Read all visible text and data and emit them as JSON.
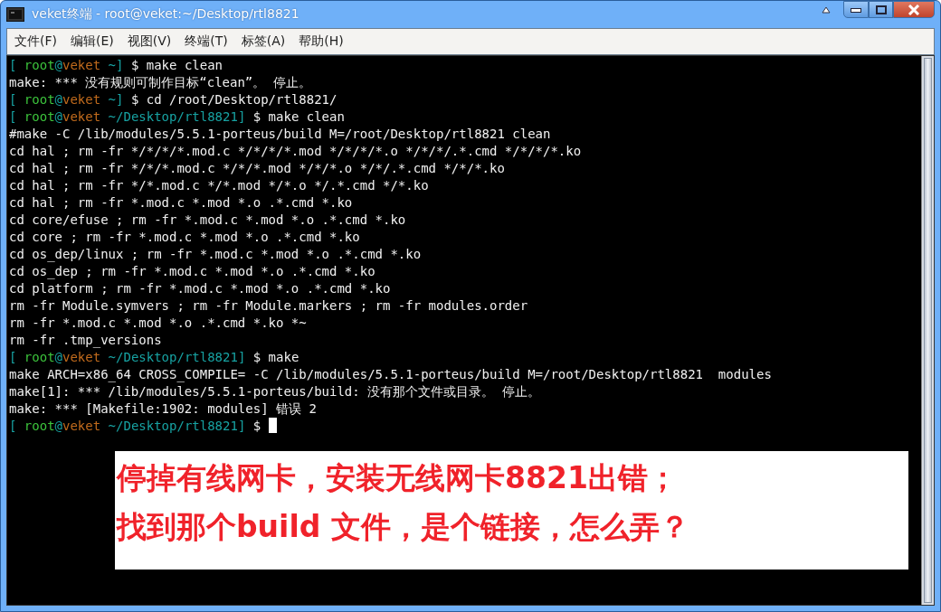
{
  "window": {
    "title": "veket终端 - root@veket:~/Desktop/rtl8821"
  },
  "menu": [
    "文件(F)",
    "编辑(E)",
    "视图(V)",
    "终端(T)",
    "标签(A)",
    "帮助(H)"
  ],
  "terminal": {
    "lines": [
      {
        "kind": "prompt",
        "segments": [
          {
            "text": "[ ",
            "color": "#17a2a2"
          },
          {
            "text": "root",
            "color": "#3cc43c"
          },
          {
            "text": "@",
            "color": "#17a2a2"
          },
          {
            "text": "veket",
            "color": "#c06a1c"
          },
          {
            "text": " ~] ",
            "color": "#17a2a2"
          },
          {
            "text": "$ make clean",
            "color": "#f0f0f0"
          }
        ]
      },
      {
        "kind": "output",
        "text": "make: *** 没有规则可制作目标“clean”。 停止。"
      },
      {
        "kind": "prompt",
        "segments": [
          {
            "text": "[ ",
            "color": "#17a2a2"
          },
          {
            "text": "root",
            "color": "#3cc43c"
          },
          {
            "text": "@",
            "color": "#17a2a2"
          },
          {
            "text": "veket",
            "color": "#c06a1c"
          },
          {
            "text": " ~] ",
            "color": "#17a2a2"
          },
          {
            "text": "$ cd /root/Desktop/rtl8821/",
            "color": "#f0f0f0"
          }
        ]
      },
      {
        "kind": "prompt",
        "segments": [
          {
            "text": "[ ",
            "color": "#17a2a2"
          },
          {
            "text": "root",
            "color": "#3cc43c"
          },
          {
            "text": "@",
            "color": "#17a2a2"
          },
          {
            "text": "veket",
            "color": "#c06a1c"
          },
          {
            "text": " ~/Desktop/rtl8821] ",
            "color": "#17a2a2"
          },
          {
            "text": "$ make clean",
            "color": "#f0f0f0"
          }
        ]
      },
      {
        "kind": "output",
        "text": "#make -C /lib/modules/5.5.1-porteus/build M=/root/Desktop/rtl8821 clean"
      },
      {
        "kind": "output",
        "text": "cd hal ; rm -fr */*/*/*.mod.c */*/*/*.mod */*/*/*.o */*/*/.*.cmd */*/*/*.ko"
      },
      {
        "kind": "output",
        "text": "cd hal ; rm -fr */*/*.mod.c */*/*.mod */*/*.o */*/.*.cmd */*/*.ko"
      },
      {
        "kind": "output",
        "text": "cd hal ; rm -fr */*.mod.c */*.mod */*.o */.*.cmd */*.ko"
      },
      {
        "kind": "output",
        "text": "cd hal ; rm -fr *.mod.c *.mod *.o .*.cmd *.ko"
      },
      {
        "kind": "output",
        "text": "cd core/efuse ; rm -fr *.mod.c *.mod *.o .*.cmd *.ko"
      },
      {
        "kind": "output",
        "text": "cd core ; rm -fr *.mod.c *.mod *.o .*.cmd *.ko"
      },
      {
        "kind": "output",
        "text": "cd os_dep/linux ; rm -fr *.mod.c *.mod *.o .*.cmd *.ko"
      },
      {
        "kind": "output",
        "text": "cd os_dep ; rm -fr *.mod.c *.mod *.o .*.cmd *.ko"
      },
      {
        "kind": "output",
        "text": "cd platform ; rm -fr *.mod.c *.mod *.o .*.cmd *.ko"
      },
      {
        "kind": "output",
        "text": "rm -fr Module.symvers ; rm -fr Module.markers ; rm -fr modules.order"
      },
      {
        "kind": "output",
        "text": "rm -fr *.mod.c *.mod *.o .*.cmd *.ko *~"
      },
      {
        "kind": "output",
        "text": "rm -fr .tmp_versions"
      },
      {
        "kind": "prompt",
        "segments": [
          {
            "text": "[ ",
            "color": "#17a2a2"
          },
          {
            "text": "root",
            "color": "#3cc43c"
          },
          {
            "text": "@",
            "color": "#17a2a2"
          },
          {
            "text": "veket",
            "color": "#c06a1c"
          },
          {
            "text": " ~/Desktop/rtl8821] ",
            "color": "#17a2a2"
          },
          {
            "text": "$ make",
            "color": "#f0f0f0"
          }
        ]
      },
      {
        "kind": "output",
        "text": "make ARCH=x86_64 CROSS_COMPILE= -C /lib/modules/5.5.1-porteus/build M=/root/Desktop/rtl8821  modules"
      },
      {
        "kind": "output",
        "text": "make[1]: *** /lib/modules/5.5.1-porteus/build: 没有那个文件或目录。 停止。"
      },
      {
        "kind": "output",
        "text": "make: *** [Makefile:1902: modules] 错误 2"
      },
      {
        "kind": "prompt",
        "cursor": true,
        "segments": [
          {
            "text": "[ ",
            "color": "#17a2a2"
          },
          {
            "text": "root",
            "color": "#3cc43c"
          },
          {
            "text": "@",
            "color": "#17a2a2"
          },
          {
            "text": "veket",
            "color": "#c06a1c"
          },
          {
            "text": " ~/Desktop/rtl8821] ",
            "color": "#17a2a2"
          },
          {
            "text": "$ ",
            "color": "#f0f0f0"
          }
        ]
      }
    ]
  },
  "annotation": [
    "停掉有线网卡，安装无线网卡8821出错；",
    "找到那个build 文件，是个链接，怎么弄？"
  ]
}
